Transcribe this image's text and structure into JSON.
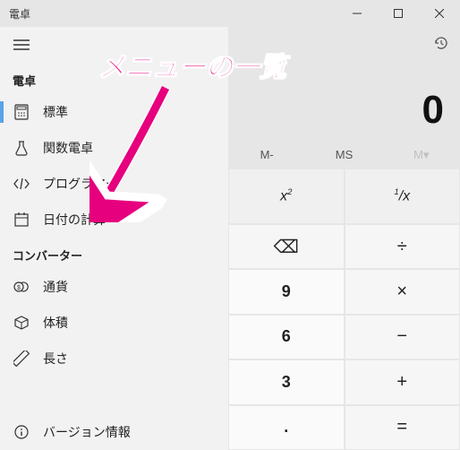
{
  "window": {
    "title": "電卓"
  },
  "sidebar": {
    "section_calc": "電卓",
    "section_conv": "コンバーター",
    "items": {
      "standard": "標準",
      "scientific": "関数電卓",
      "programmer": "プログラマー",
      "date": "日付の計算",
      "currency": "通貨",
      "volume": "体積",
      "length": "長さ",
      "about": "バージョン情報"
    }
  },
  "calc": {
    "display": "0",
    "mem": {
      "mminus": "M-",
      "ms": "MS",
      "mlist": "M▾"
    },
    "funcs": {
      "xsq_base": "x",
      "xsq_sup": "2",
      "inv_n": "1",
      "inv_d": "x"
    },
    "keys": {
      "bksp": "⌫",
      "div": "÷",
      "n9": "9",
      "mul": "×",
      "n6": "6",
      "sub": "−",
      "n3": "3",
      "add": "+",
      "dot": ".",
      "eq": "="
    }
  },
  "annotation": {
    "text": "メニューの一覧"
  }
}
